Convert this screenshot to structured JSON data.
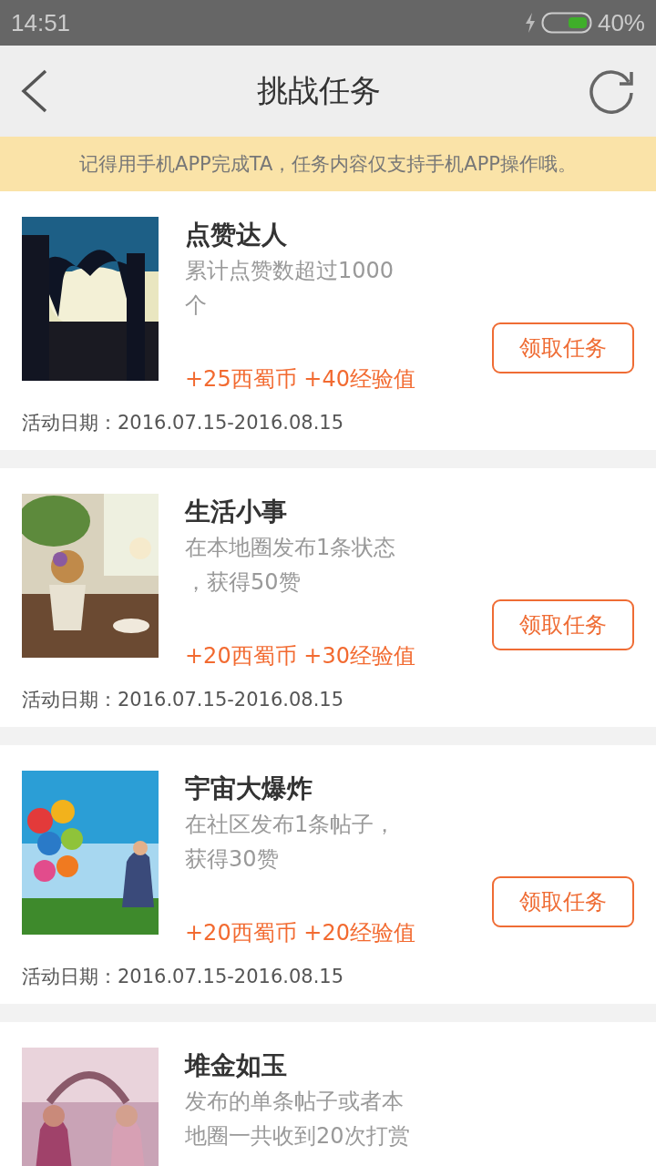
{
  "status_bar": {
    "time": "14:51",
    "battery": "40%"
  },
  "header": {
    "title": "挑战任务"
  },
  "notice": "记得用手机APP完成TA，任务内容仅支持手机APP操作哦。",
  "tasks": [
    {
      "title": "点赞达人",
      "description_lines": [
        "累计点赞数超过1000",
        "个"
      ],
      "reward": "+25西蜀币 +40经验值",
      "button": "领取任务",
      "date": "活动日期：2016.07.15-2016.08.15"
    },
    {
      "title": "生活小事",
      "description_lines": [
        "在本地圈发布1条状态",
        "，获得50赞"
      ],
      "reward": "+20西蜀币 +30经验值",
      "button": "领取任务",
      "date": "活动日期：2016.07.15-2016.08.15"
    },
    {
      "title": "宇宙大爆炸",
      "description_lines": [
        "在社区发布1条帖子，",
        "获得30赞"
      ],
      "reward": "+20西蜀币 +20经验值",
      "button": "领取任务",
      "date": "活动日期：2016.07.15-2016.08.15"
    },
    {
      "title": "堆金如玉",
      "description_lines": [
        "发布的单条帖子或者本",
        "地圈一共收到20次打赏"
      ]
    }
  ]
}
